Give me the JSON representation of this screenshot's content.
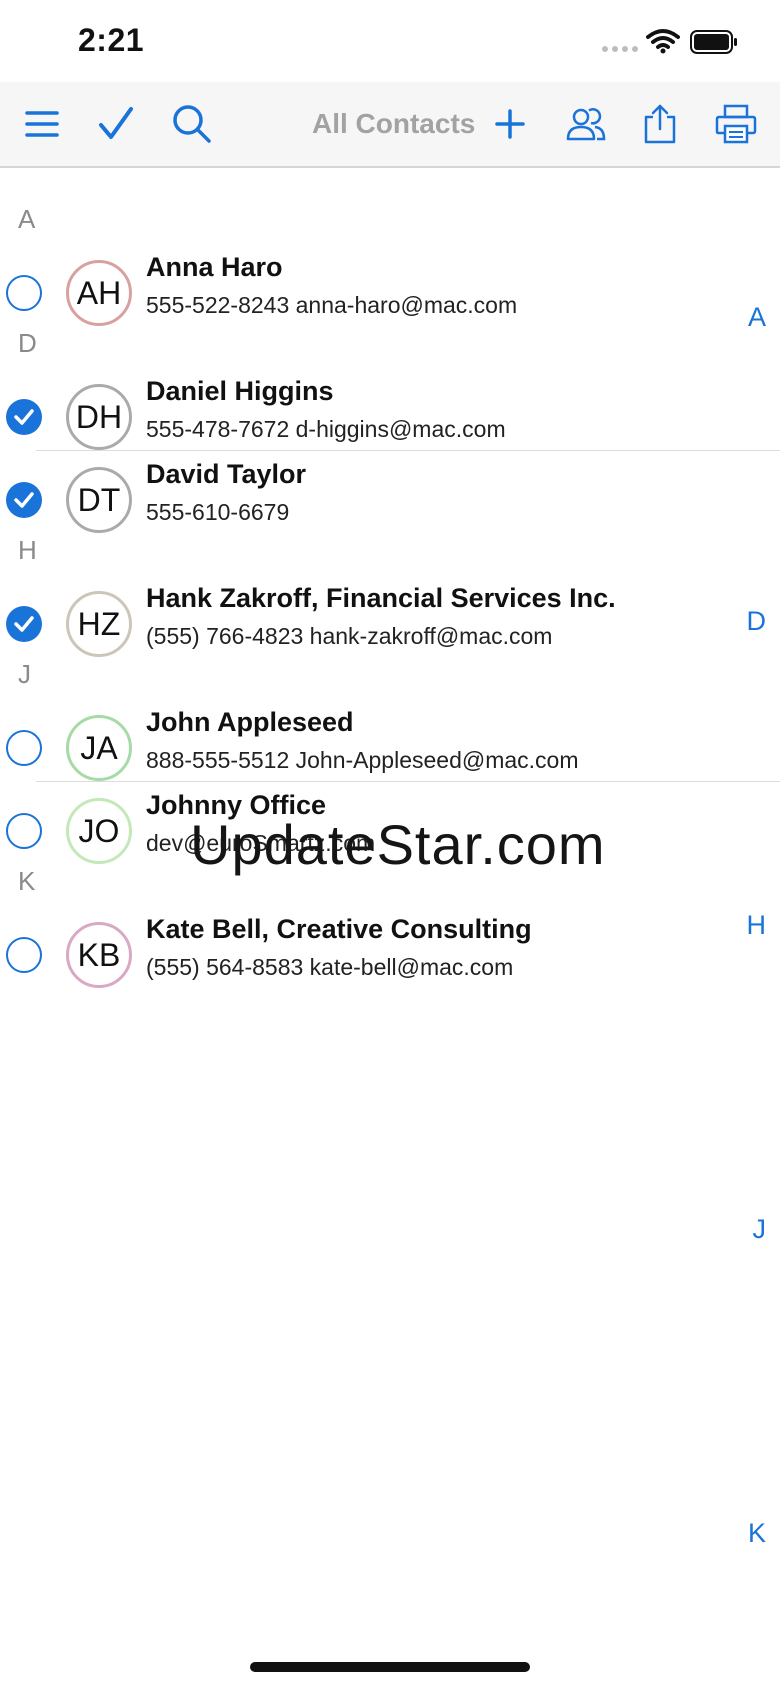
{
  "status_bar": {
    "time": "2:21"
  },
  "toolbar": {
    "title": "All Contacts",
    "accent_color": "#1a73d9",
    "icons": [
      "menu-icon",
      "checkmark-icon",
      "search-icon",
      "add-icon",
      "groups-icon",
      "share-icon",
      "print-icon"
    ]
  },
  "sections": [
    "A",
    "D",
    "H",
    "J",
    "K"
  ],
  "contacts": [
    {
      "initials": "AH",
      "name": "Anna Haro",
      "detail": "555-522-8243 anna-haro@mac.com",
      "selected": false,
      "ring": "#d9a0a0"
    },
    {
      "initials": "DH",
      "name": "Daniel Higgins",
      "detail": "555-478-7672 d-higgins@mac.com",
      "selected": true,
      "ring": "#aaaaaa"
    },
    {
      "initials": "DT",
      "name": "David Taylor",
      "detail": "555-610-6679",
      "selected": true,
      "ring": "#aaaaaa"
    },
    {
      "initials": "HZ",
      "name": "Hank Zakroff, Financial Services Inc.",
      "detail": "(555) 766-4823 hank-zakroff@mac.com",
      "selected": true,
      "ring": "#ccc6b8"
    },
    {
      "initials": "JA",
      "name": "John Appleseed",
      "detail": "888-555-5512 John-Appleseed@mac.com",
      "selected": false,
      "ring": "#a6dba6"
    },
    {
      "initials": "JO",
      "name": "Johnny Office",
      "detail": "dev@euroSmartz.com",
      "selected": false,
      "ring": "#c4e8b8"
    },
    {
      "initials": "KB",
      "name": "Kate Bell, Creative Consulting",
      "detail": "(555) 564-8583 kate-bell@mac.com",
      "selected": false,
      "ring": "#d9a8c4"
    }
  ],
  "index": [
    "A",
    "D",
    "H",
    "J",
    "K"
  ],
  "watermark": "UpdateStar.com"
}
